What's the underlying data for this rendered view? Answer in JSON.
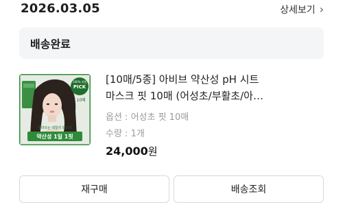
{
  "order": {
    "date": "2026.03.05",
    "detail_link": "상세보기",
    "detail_icon": "chevron-right-icon",
    "status": "배송완료"
  },
  "product": {
    "title_line1": "[10매/5종] 아비브 약산성 pH 시트",
    "title_line2": "마스크 핏 10매 (어성초/부활초/아…",
    "option": "옵션 : 어성초 핏 10매",
    "quantity": "수량 : 1개",
    "price_amount": "24,000",
    "price_unit": "원",
    "thumbnail": {
      "badge_top": "100% 리얼",
      "badge_main": "PICK",
      "badge_count": "10매",
      "caption_small": "골라쓰는 데일리 마스크",
      "caption_main": "약산성 1일 1핏",
      "accent_color": "#2e8b3a",
      "badge_color": "#1f6f2c"
    }
  },
  "actions": {
    "rebuy": "재구매",
    "track": "배송조회"
  }
}
